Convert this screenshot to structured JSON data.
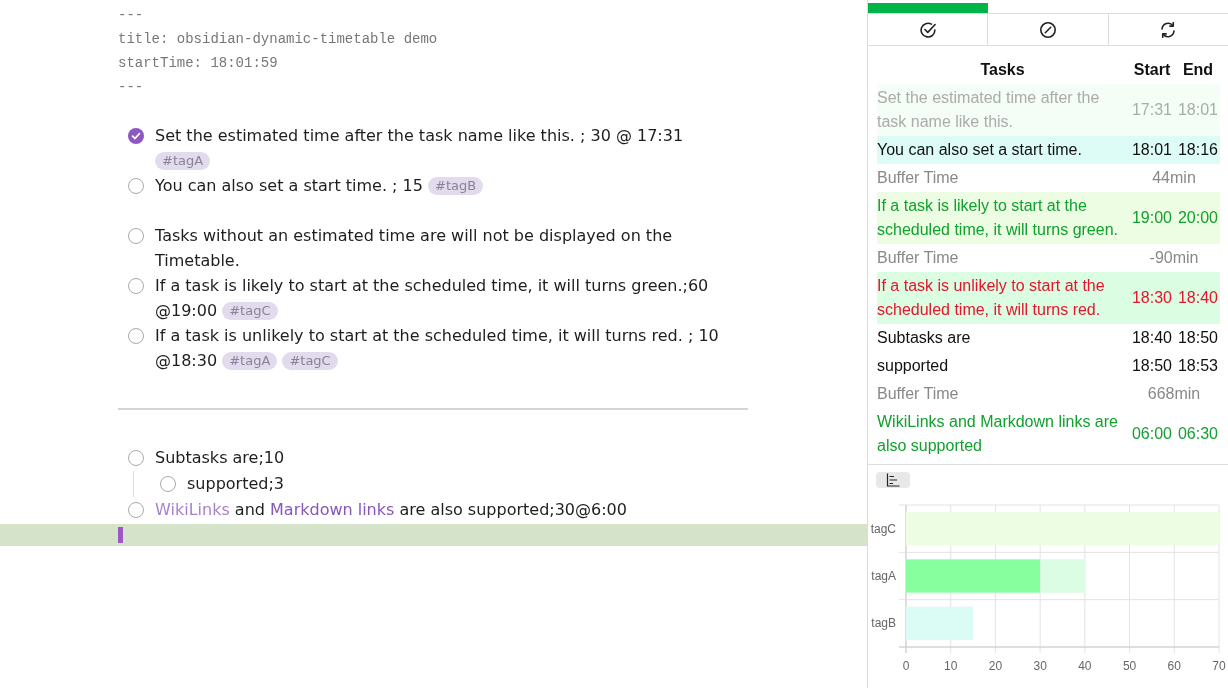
{
  "editor": {
    "blocks": [
      {
        "kind": "frontmatter",
        "lines": [
          "---",
          "title: obsidian-dynamic-timetable demo",
          "startTime: 18:01:59",
          "---"
        ]
      },
      {
        "kind": "tasks",
        "tasks": [
          {
            "checked": true,
            "text": "Set the estimated time after the task name like this. ; 30 @ 17:31",
            "tags": [
              "#tagA"
            ]
          },
          {
            "checked": false,
            "text": "You can also set a start time. ; 15",
            "tags": [
              "#tagB"
            ]
          }
        ]
      },
      {
        "kind": "tasks",
        "tasks": [
          {
            "checked": false,
            "text": "Tasks without an estimated time are will not be displayed on the Timetable."
          },
          {
            "checked": false,
            "text": "If a task is likely to start at the scheduled time, it will turns green.;60 @19:00",
            "tags": [
              "#tagC"
            ]
          },
          {
            "checked": false,
            "text": "If a task is unlikely to start at the scheduled time, it will turns red. ; 10 @18:30",
            "tags": [
              "#tagA",
              "#tagC"
            ]
          }
        ]
      },
      {
        "kind": "rule"
      },
      {
        "kind": "tasks",
        "tasks": [
          {
            "checked": false,
            "text": "Subtasks are;10",
            "children": [
              {
                "checked": false,
                "text": "supported;3"
              }
            ]
          },
          {
            "checked": false,
            "parts": [
              {
                "kind": "wikilink",
                "text": "WikiLinks"
              },
              {
                "kind": "text",
                "text": " and "
              },
              {
                "kind": "link",
                "text": "Markdown links"
              },
              {
                "kind": "text",
                "text": " are also supported;30@6:00"
              }
            ]
          }
        ]
      }
    ]
  },
  "timetable": {
    "progress": {
      "level": 0.333
    },
    "columns": [
      "Tasks",
      "Start",
      "End"
    ],
    "rows": [
      {
        "kind": "done",
        "task": "Set the estimated time after the task name like this.",
        "start": "17:31",
        "end": "18:01",
        "color": "#f4fdf6"
      },
      {
        "kind": "task",
        "task": "You can also set a start time.",
        "start": "18:01",
        "end": "18:16",
        "color": "#dcfcf5"
      },
      {
        "kind": "buffer",
        "task": "Buffer Time",
        "duration": "44min"
      },
      {
        "kind": "on_time",
        "task": "If a task is likely to start at the scheduled time, it will turns green.",
        "start": "19:00",
        "end": "20:00",
        "color": "#edfde3"
      },
      {
        "kind": "buffer",
        "task": "Buffer Time",
        "duration": "-90min"
      },
      {
        "kind": "late",
        "task": "If a task is unlikely to start at the scheduled time, it will turns red.",
        "start": "18:30",
        "end": "18:40",
        "color": "#dbfde2"
      },
      {
        "kind": "task",
        "task": "Subtasks are",
        "start": "18:40",
        "end": "18:50"
      },
      {
        "kind": "task",
        "task": "supported",
        "start": "18:50",
        "end": "18:53"
      },
      {
        "kind": "buffer",
        "task": "Buffer Time",
        "duration": "668min"
      },
      {
        "kind": "on_time",
        "task": "WikiLinks and Markdown links are also supported",
        "start": "06:00",
        "end": "06:30"
      }
    ]
  },
  "chart": {
    "chart_data": [
      {
        "type": "bar",
        "orientation": "horizontal",
        "stacked": true,
        "categories": [
          "tagC",
          "tagA",
          "tagB"
        ],
        "series": [
          {
            "color": "#88ff9f",
            "values": [
              null,
              30,
              null
            ]
          },
          {
            "colors": [
              "#ecfde3",
              "#dafde3",
              "#dbfcf4"
            ],
            "values": [
              70,
              10,
              15
            ]
          }
        ],
        "xlim": [
          0,
          70
        ],
        "xticks": [
          0,
          10,
          20,
          30,
          40,
          50,
          60,
          70
        ],
        "grid": true
      }
    ]
  }
}
